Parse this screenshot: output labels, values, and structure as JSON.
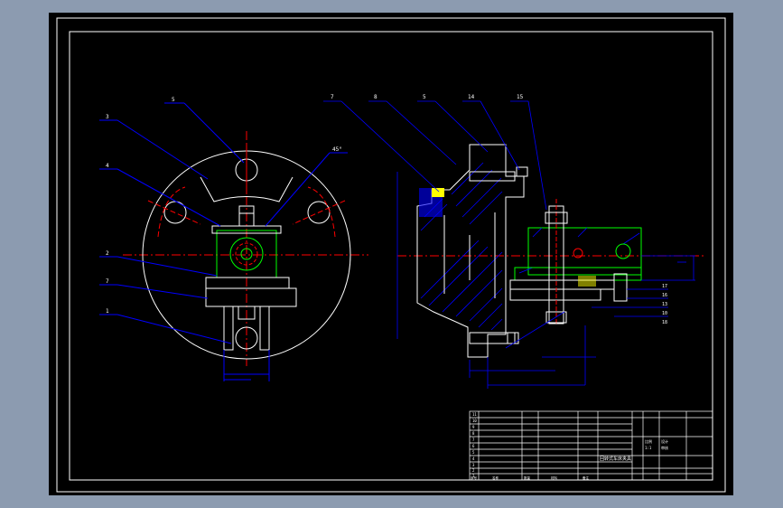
{
  "colors": {
    "background": "#8c9bb0",
    "paper": "#000000",
    "frame": "#ffffff",
    "leader": "#0000ff",
    "center": "#ff0000",
    "part": "#00ff00",
    "hatch": "#0000ff",
    "dimension": "#0000ff",
    "text": "#ffffff"
  },
  "drawing": {
    "labels": {
      "front_view": [
        "5",
        "3",
        "4",
        "2",
        "7",
        "1",
        "45°"
      ],
      "section_view": [
        "7",
        "8",
        "5",
        "14",
        "15",
        "17",
        "16",
        "13",
        "10",
        "18"
      ]
    },
    "title_block": {
      "title": "回转式车床夹具",
      "parts_rows": [
        [
          "11",
          "",
          "",
          "",
          "",
          ""
        ],
        [
          "10",
          "",
          "",
          "",
          "",
          ""
        ],
        [
          "9",
          "",
          "",
          "",
          "",
          ""
        ],
        [
          "8",
          "",
          "",
          "",
          "",
          ""
        ],
        [
          "7",
          "",
          "",
          "",
          "",
          ""
        ],
        [
          "6",
          "",
          "",
          "",
          "",
          ""
        ],
        [
          "5",
          "",
          "",
          "",
          "",
          ""
        ],
        [
          "4",
          "",
          "",
          "",
          "",
          ""
        ],
        [
          "3",
          "",
          "",
          "",
          "",
          ""
        ],
        [
          "2",
          "",
          "",
          "",
          "",
          ""
        ],
        [
          "1",
          "",
          "",
          "",
          "",
          ""
        ]
      ],
      "header": [
        "序号",
        "名称",
        "数量",
        "材料",
        "备注"
      ],
      "sign_fields": [
        "设计",
        "审核",
        "比例",
        "1:1"
      ]
    }
  }
}
